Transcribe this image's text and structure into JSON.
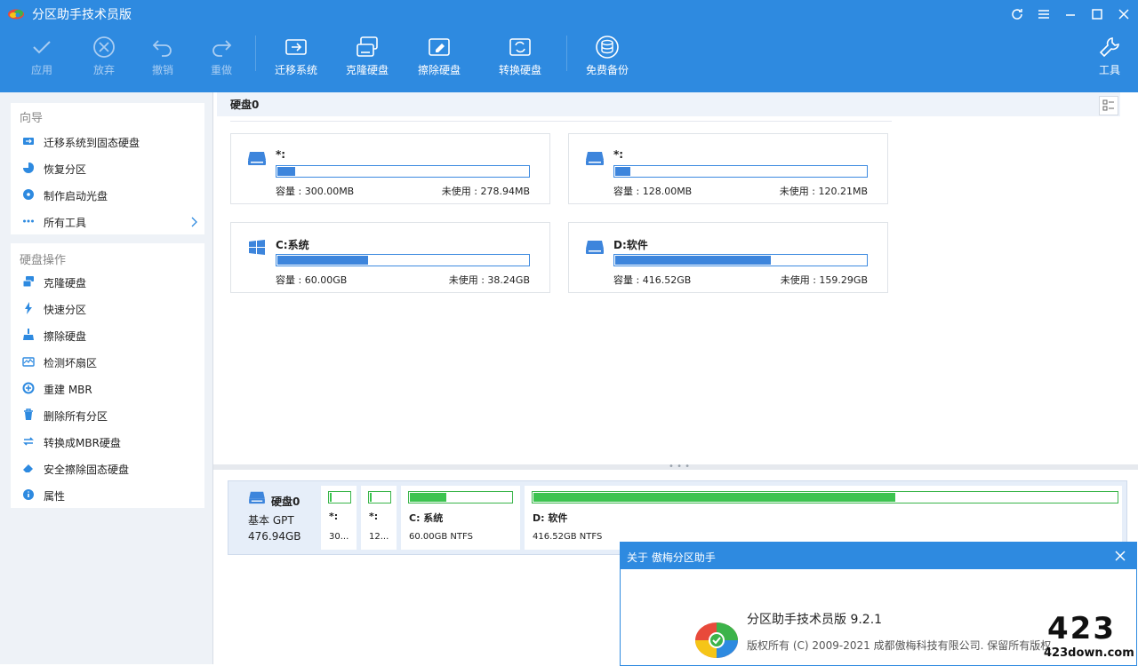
{
  "app": {
    "title": "分区助手技术员版"
  },
  "toolbar": {
    "apply": "应用",
    "discard": "放弃",
    "undo": "撤销",
    "redo": "重做",
    "migrate": "迁移系统",
    "clone": "克隆硬盘",
    "wipe": "擦除硬盘",
    "convert": "转换硬盘",
    "backup": "免费备份",
    "tools": "工具"
  },
  "sidebar": {
    "wizard_title": "向导",
    "wizard_items": [
      "迁移系统到固态硬盘",
      "恢复分区",
      "制作启动光盘",
      "所有工具"
    ],
    "ops_title": "硬盘操作",
    "ops_items": [
      "克隆硬盘",
      "快速分区",
      "擦除硬盘",
      "检测坏扇区",
      "重建 MBR",
      "删除所有分区",
      "转换成MBR硬盘",
      "安全擦除固态硬盘",
      "属性"
    ]
  },
  "disk": {
    "header": "硬盘0",
    "partitions": [
      {
        "name": "*:",
        "cap": "容量 : 300.00MB",
        "free": "未使用 : 278.94MB",
        "used_fraction": 0.07,
        "icon": "disk-icon"
      },
      {
        "name": "*:",
        "cap": "容量 : 128.00MB",
        "free": "未使用 : 120.21MB",
        "used_fraction": 0.06,
        "icon": "disk-icon"
      },
      {
        "name": "C:系统",
        "cap": "容量 : 60.00GB",
        "free": "未使用 : 38.24GB",
        "used_fraction": 0.36,
        "icon": "windows-icon"
      },
      {
        "name": "D:软件",
        "cap": "容量 : 416.52GB",
        "free": "未使用 : 159.29GB",
        "used_fraction": 0.62,
        "icon": "disk-icon"
      }
    ]
  },
  "diskmap": {
    "name": "硬盘0",
    "type": "基本 GPT",
    "size": "476.94GB",
    "segments": [
      {
        "name": "*:",
        "info": "30...",
        "used_fraction": 0.1
      },
      {
        "name": "*:",
        "info": "12...",
        "used_fraction": 0.1
      },
      {
        "name": "C: 系统",
        "info": "60.00GB NTFS",
        "used_fraction": 0.36
      },
      {
        "name": "D: 软件",
        "info": "416.52GB NTFS",
        "used_fraction": 0.62
      }
    ]
  },
  "about": {
    "title": "关于 傲梅分区助手",
    "product": "分区助手技术员版 9.2.1",
    "copyright": "版权所有 (C) 2009-2021 成都傲梅科技有限公司. 保留所有版权."
  },
  "watermark": {
    "line1": "423",
    "line2": "423down.com"
  },
  "colors": {
    "accent": "#2e8ae0",
    "bar_blue": "#3d85dc",
    "bar_green": "#3cc34f"
  }
}
